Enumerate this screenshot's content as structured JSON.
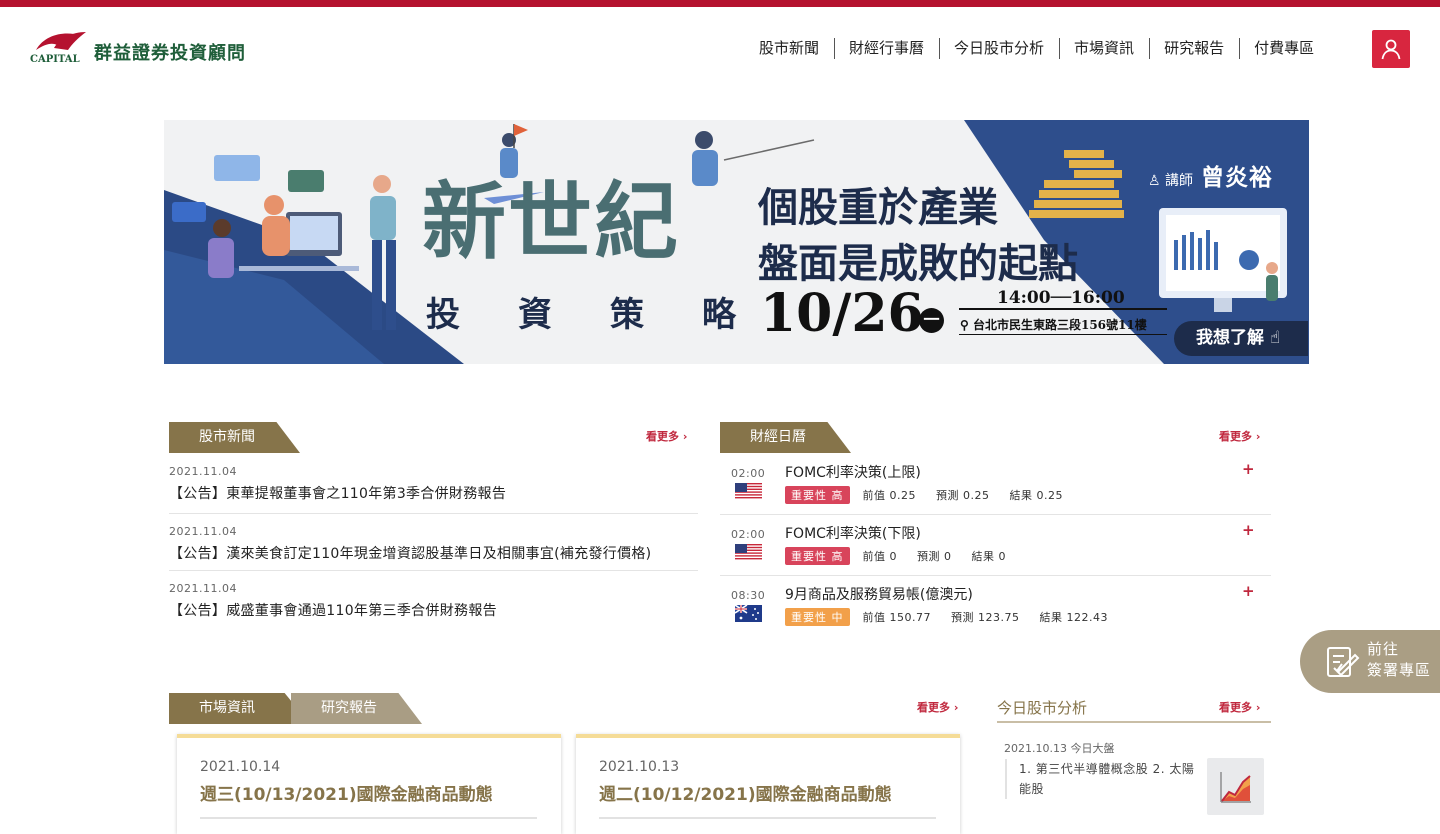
{
  "header": {
    "logo_text": "群益證券投資顧問",
    "logo_mark_text": "CAPITAL",
    "nav": [
      "股市新聞",
      "財經行事曆",
      "今日股市分析",
      "市場資訊",
      "研究報告",
      "付費專區"
    ]
  },
  "banner": {
    "title": "新世紀",
    "subtitle": "投資策略",
    "headline1": "個股重於產業",
    "headline2": "盤面是成敗的起點",
    "date": "10/26",
    "weekday_mark": "一",
    "time": "14:00──16:00",
    "address": "台北市民生東路三段156號11樓",
    "speaker_label": "講師",
    "speaker_name": "曾炎裕",
    "cta": "我想了解"
  },
  "news": {
    "tab": "股市新聞",
    "more": "看更多 ›",
    "items": [
      {
        "date": "2021.11.04",
        "title": "【公告】東華提報董事會之110年第3季合併財務報告"
      },
      {
        "date": "2021.11.04",
        "title": "【公告】漢來美食訂定110年現金增資認股基準日及相關事宜(補充發行價格)"
      },
      {
        "date": "2021.11.04",
        "title": "【公告】威盛董事會通過110年第三季合併財務報告"
      }
    ]
  },
  "calendar": {
    "tab": "財經日曆",
    "more": "看更多 ›",
    "items": [
      {
        "time": "02:00",
        "flag": "us-flag",
        "title": "FOMC利率決策(上限)",
        "importance": "重要性 高",
        "level": "high",
        "prev": "前值 0.25",
        "forecast": "預測 0.25",
        "result": "結果 0.25"
      },
      {
        "time": "02:00",
        "flag": "us-flag",
        "title": "FOMC利率決策(下限)",
        "importance": "重要性 高",
        "level": "high",
        "prev": "前值 0",
        "forecast": "預測 0",
        "result": "結果 0"
      },
      {
        "time": "08:30",
        "flag": "au-flag",
        "title": "9月商品及服務貿易帳(億澳元)",
        "importance": "重要性 中",
        "level": "mid",
        "prev": "前值 150.77",
        "forecast": "預測 123.75",
        "result": "結果 122.43"
      }
    ]
  },
  "market": {
    "tab1": "市場資訊",
    "tab2": "研究報告",
    "more": "看更多 ›",
    "cards": [
      {
        "date": "2021.10.14",
        "title": "週三(10/13/2021)國際金融商品動態"
      },
      {
        "date": "2021.10.13",
        "title": "週二(10/12/2021)國際金融商品動態"
      }
    ]
  },
  "analysis": {
    "title": "今日股市分析",
    "more": "看更多 ›",
    "date": "2021.10.13 今日大盤",
    "body": "1. 第三代半導體概念股 2. 太陽能股"
  },
  "float_sign": {
    "line1": "前往",
    "line2": "簽署專區"
  },
  "colors": {
    "brand_red": "#b5122f",
    "olive": "#86744a",
    "olive_light": "#a99d84",
    "accent_red": "#c0283e"
  }
}
